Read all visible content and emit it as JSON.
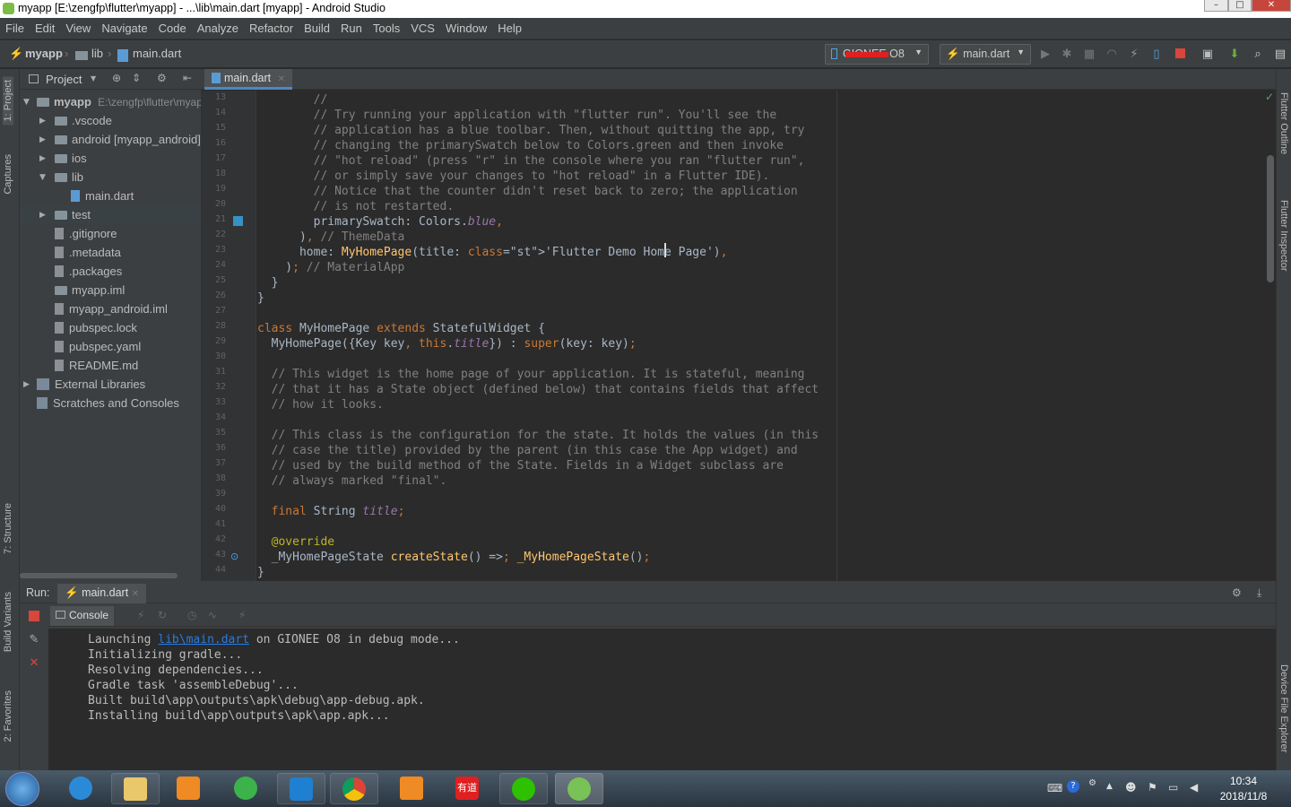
{
  "window": {
    "title": "myapp [E:\\zengfp\\flutter\\myapp] - ...\\lib\\main.dart [myapp] - Android Studio"
  },
  "menu": [
    "File",
    "Edit",
    "View",
    "Navigate",
    "Code",
    "Analyze",
    "Refactor",
    "Build",
    "Run",
    "Tools",
    "VCS",
    "Window",
    "Help"
  ],
  "breadcrumb": {
    "project": "myapp",
    "folder": "lib",
    "file": "main.dart"
  },
  "toolbar": {
    "device": "GIONEE O8",
    "run_config": "main.dart"
  },
  "left_tabs": {
    "project": "1: Project",
    "captures": "Captures",
    "structure": "7: Structure",
    "build_variants": "Build Variants",
    "favorites": "2: Favorites"
  },
  "right_tabs": {
    "outline": "Flutter Outline",
    "inspector": "Flutter Inspector",
    "device_explorer": "Device File Explorer"
  },
  "project_panel": {
    "header": "Project",
    "root_name": "myapp",
    "root_path": "E:\\zengfp\\flutter\\myapp",
    "items": [
      ".vscode",
      "android [myapp_android]",
      "ios",
      "lib",
      "main.dart",
      "test",
      ".gitignore",
      ".metadata",
      ".packages",
      "myapp.iml",
      "myapp_android.iml",
      "pubspec.lock",
      "pubspec.yaml",
      "README.md",
      "External Libraries",
      "Scratches and Consoles"
    ]
  },
  "editor": {
    "tab": "main.dart",
    "line_numbers": [
      "13",
      "14",
      "15",
      "16",
      "17",
      "18",
      "19",
      "20",
      "21",
      "22",
      "23",
      "24",
      "25",
      "26",
      "27",
      "28",
      "29",
      "30",
      "31",
      "32",
      "33",
      "34",
      "35",
      "36",
      "37",
      "38",
      "39",
      "40",
      "41",
      "42",
      "43",
      "44"
    ],
    "lines": [
      "        //",
      "        // Try running your application with \"flutter run\". You'll see the",
      "        // application has a blue toolbar. Then, without quitting the app, try",
      "        // changing the primarySwatch below to Colors.green and then invoke",
      "        // \"hot reload\" (press \"r\" in the console where you ran \"flutter run\",",
      "        // or simply save your changes to \"hot reload\" in a Flutter IDE).",
      "        // Notice that the counter didn't reset back to zero; the application",
      "        // is not restarted.",
      "        primarySwatch: Colors.blue,",
      "      ), // ThemeData",
      "      home: MyHomePage(title: 'Flutter Demo Home Page'),",
      "    ); // MaterialApp",
      "  }",
      "}",
      "",
      "class MyHomePage extends StatefulWidget {",
      "  MyHomePage({Key key, this.title}) : super(key: key);",
      "",
      "  // This widget is the home page of your application. It is stateful, meaning",
      "  // that it has a State object (defined below) that contains fields that affect",
      "  // how it looks.",
      "",
      "  // This class is the configuration for the state. It holds the values (in this",
      "  // case the title) provided by the parent (in this case the App widget) and",
      "  // used by the build method of the State. Fields in a Widget subclass are",
      "  // always marked \"final\".",
      "",
      "  final String title;",
      "",
      "  @override",
      "  _MyHomePageState createState() => _MyHomePageState();",
      "}"
    ]
  },
  "run_panel": {
    "label": "Run:",
    "tab": "main.dart",
    "console_tab": "Console",
    "output": {
      "l1_pre": "Launching ",
      "l1_link": "lib\\main.dart",
      "l1_post": " on GIONEE O8 in debug mode...",
      "l2": "Initializing gradle...",
      "l3": "Resolving dependencies...",
      "l4": "Gradle task 'assembleDebug'...",
      "l5": "Built build\\app\\outputs\\apk\\debug\\app-debug.apk.",
      "l6": "Installing build\\app\\outputs\\apk\\app.apk..."
    }
  },
  "taskbar": {
    "time": "10:34",
    "date": "2018/11/8",
    "youdao_label": "有道"
  },
  "colors": {
    "keyword": "#cc7832",
    "comment": "#808080",
    "string": "#6a8759",
    "function": "#ffc66d",
    "field": "#9876aa",
    "accent": "#4a88c7"
  }
}
